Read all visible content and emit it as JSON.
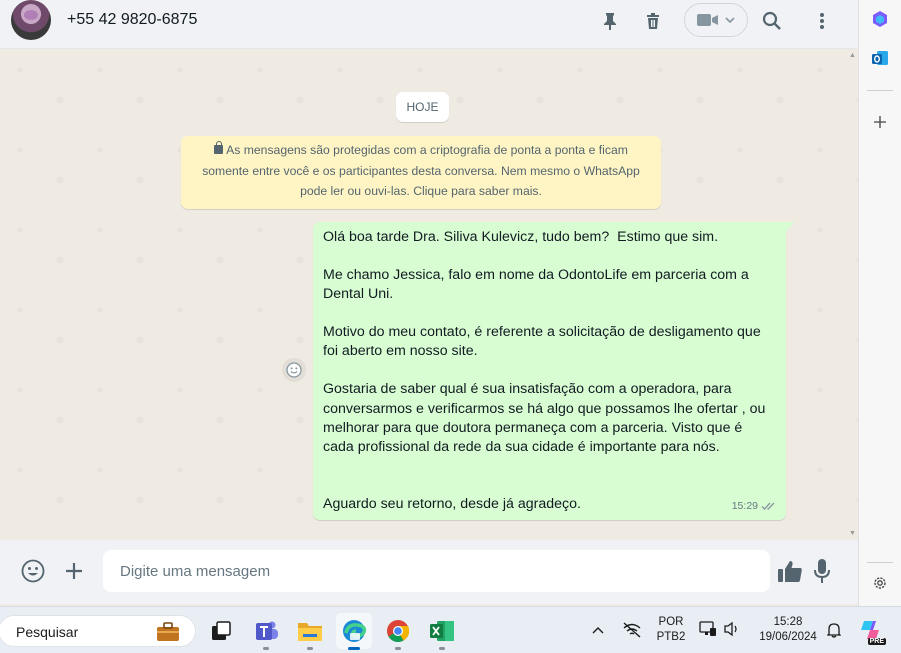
{
  "header": {
    "contact": "+55 42 9820-6875"
  },
  "chat": {
    "date_chip": "HOJE",
    "encryption_notice": "As mensagens são protegidas com a criptografia de ponta a ponta e ficam somente entre você e os participantes desta conversa. Nem mesmo o WhatsApp pode ler ou ouvi-las. Clique para saber mais.",
    "message": {
      "lines": [
        "Olá boa tarde Dra. Siliva Kulevicz, tudo bem?  Estimo que sim.",
        "",
        "Me chamo Jessica, falo em nome da OdontoLife em parceria com a Dental Uni.",
        "",
        "Motivo do meu contato, é referente a solicitação de desligamento que foi aberto em nosso site.",
        "",
        "Gostaria de saber qual é sua insatisfação com a operadora, para conversarmos e verificarmos se há algo que possamos lhe ofertar , ou melhorar para que doutora permaneça com a parceria. Visto que é cada profissional da rede da sua cidade é importante para nós.",
        "",
        "",
        "Aguardo seu retorno, desde já agradeço."
      ],
      "time": "15:29",
      "status": "delivered"
    }
  },
  "compose": {
    "placeholder": "Digite uma mensagem"
  },
  "taskbar": {
    "search_label": "Pesquisar",
    "lang_top": "POR",
    "lang_bottom": "PTB2",
    "time": "15:28",
    "date": "19/06/2024",
    "copilot_badge": "PRE"
  },
  "colors": {
    "outgoing_bubble": "#d9fdd3",
    "system_notice": "#fff5c4",
    "chat_background": "#efeae2",
    "icon_gray": "#54656f"
  }
}
